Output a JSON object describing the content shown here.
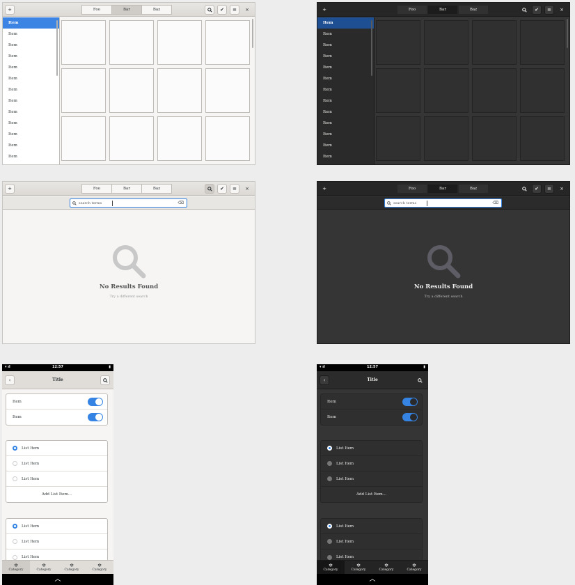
{
  "header": {
    "add_icon": "plus-icon",
    "tabs": [
      "Foo",
      "Bar",
      "Baz"
    ],
    "selected_tab": "Bar",
    "search_icon": "search-icon",
    "check_icon": "check-icon",
    "menu_icon": "hamburger-icon",
    "close_icon": "close-icon",
    "add_glyph": "+",
    "check_glyph": "✔",
    "menu_glyph": "≡",
    "close_glyph": "×"
  },
  "sidebar": {
    "items": [
      "Item",
      "Item",
      "Item",
      "Item",
      "Item",
      "Item",
      "Item",
      "Item",
      "Item",
      "Item",
      "Item",
      "Item",
      "Item"
    ],
    "selected_index": 0
  },
  "search": {
    "placeholder": "search terms",
    "clear_icon": "backspace-icon",
    "clear_glyph": "⌫"
  },
  "empty_state": {
    "icon": "magnifier-icon",
    "title": "No Results Found",
    "subtitle": "Try a different search"
  },
  "phone": {
    "status": {
      "time": "12:57",
      "left_glyphs": "▾ ıl",
      "right_glyph": "▮"
    },
    "title": "Title",
    "back_glyph": "‹",
    "search_glyph": "⌕",
    "toggles": [
      {
        "label": "Item",
        "on": true
      },
      {
        "label": "Item",
        "on": true
      }
    ],
    "list1": [
      {
        "label": "List Item",
        "selected": true
      },
      {
        "label": "List Item",
        "selected": false
      },
      {
        "label": "List Item",
        "selected": false
      }
    ],
    "add_label": "Add List Item...",
    "list2": [
      {
        "label": "List Item",
        "selected": true
      },
      {
        "label": "List Item",
        "selected": false
      },
      {
        "label": "List Item",
        "selected": false
      }
    ],
    "tabs": [
      "Category",
      "Category",
      "Category",
      "Category"
    ],
    "tab_glyph": "✲",
    "up_glyph": "︿"
  },
  "colors": {
    "accent": "#3584e4",
    "light_bg": "#f6f5f4",
    "dark_bg": "#353535"
  }
}
